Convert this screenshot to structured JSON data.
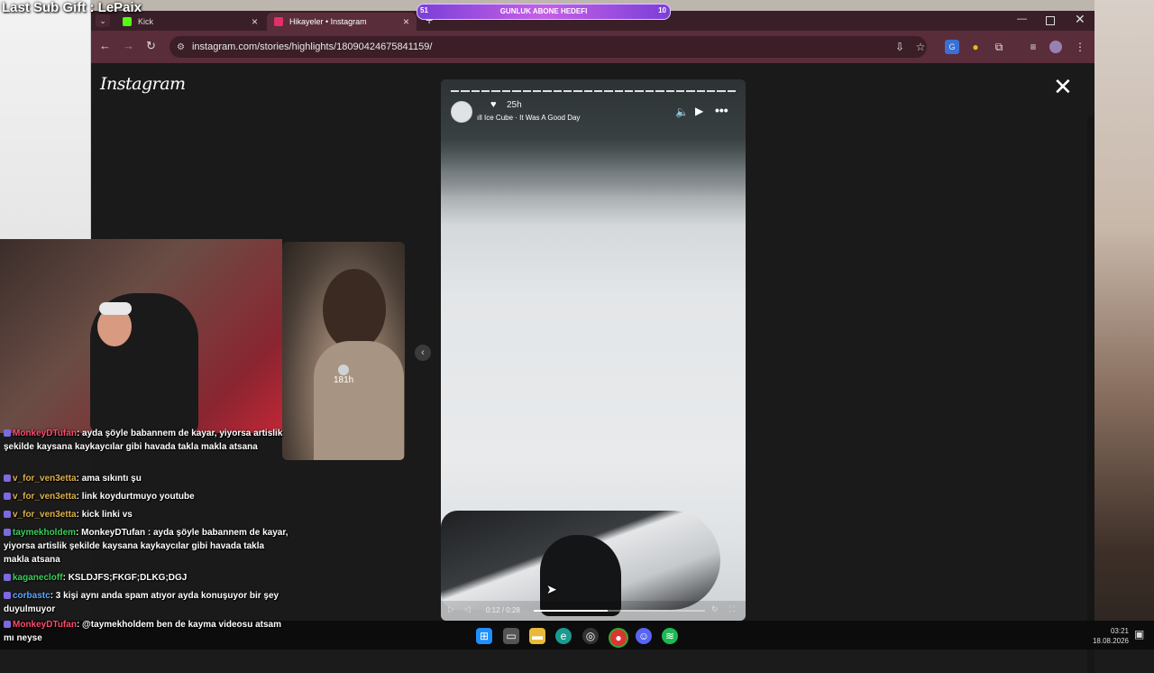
{
  "overlay": {
    "title": "Last Sub Gift : LePaix",
    "sub_goal": {
      "current": "51",
      "label": "GUNLUK ABONE HEDEFI",
      "target": "10"
    }
  },
  "browser": {
    "tabs": [
      {
        "label": "Kick",
        "favicon_color": "#53fc18"
      },
      {
        "label": "Hikayeler • Instagram",
        "favicon_color": "#e1306c"
      }
    ],
    "new_tab_icon": "+",
    "url": "instagram.com/stories/highlights/18090424675841159/",
    "window_controls": [
      "minimize",
      "maximize",
      "close"
    ]
  },
  "instagram": {
    "logo": "Instagram",
    "close_icon": "close-icon",
    "prev_story": {
      "time": "181h"
    },
    "story": {
      "time": "25h",
      "music": "Ice Cube · It Was A Good Day",
      "timecode": "0:12 / 0:28",
      "progress": 0.43,
      "segments": 28
    }
  },
  "chat": [
    {
      "user": "MonkeyDTufan",
      "color": "red",
      "text": "ayda şöyle babannem de kayar, yiyorsa artislik şekilde kaysana kaykaycılar gibi havada takla makla atsana"
    },
    {
      "user": "v_for_ven3etta",
      "color": "yellow",
      "text": "ama sıkıntı şu"
    },
    {
      "user": "v_for_ven3etta",
      "color": "yellow",
      "text": "link koydurtmuyo youtube"
    },
    {
      "user": "v_for_ven3etta",
      "color": "yellow",
      "text": "kick linki vs"
    },
    {
      "user": "taymekholdem",
      "color": "green",
      "text": "MonkeyDTufan : ayda şöyle babannem de kayar, yiyorsa artislik şekilde kaysana kaykaycılar gibi havada takla makla atsana"
    },
    {
      "user": "kaganecloff",
      "color": "green",
      "text": "KSLDJFS;FKGF;DLKG;DGJ"
    },
    {
      "user": "corbastc",
      "color": "blue",
      "text": "3 kişi aynı anda spam atıyor ayda konuşuyor bir şey duyulmuyor"
    },
    {
      "user": "MonkeyDTufan",
      "color": "red",
      "text": "@taymekholdem ben de kayma videosu atsam mı neyse"
    }
  ],
  "taskbar": {
    "apps": [
      "windows-icon",
      "file-explorer-icon",
      "folder-icon",
      "edge-icon",
      "obs-icon",
      "chrome-icon",
      "discord-icon",
      "spotify-icon"
    ],
    "time": "03:21",
    "date": "18.08.2026"
  }
}
